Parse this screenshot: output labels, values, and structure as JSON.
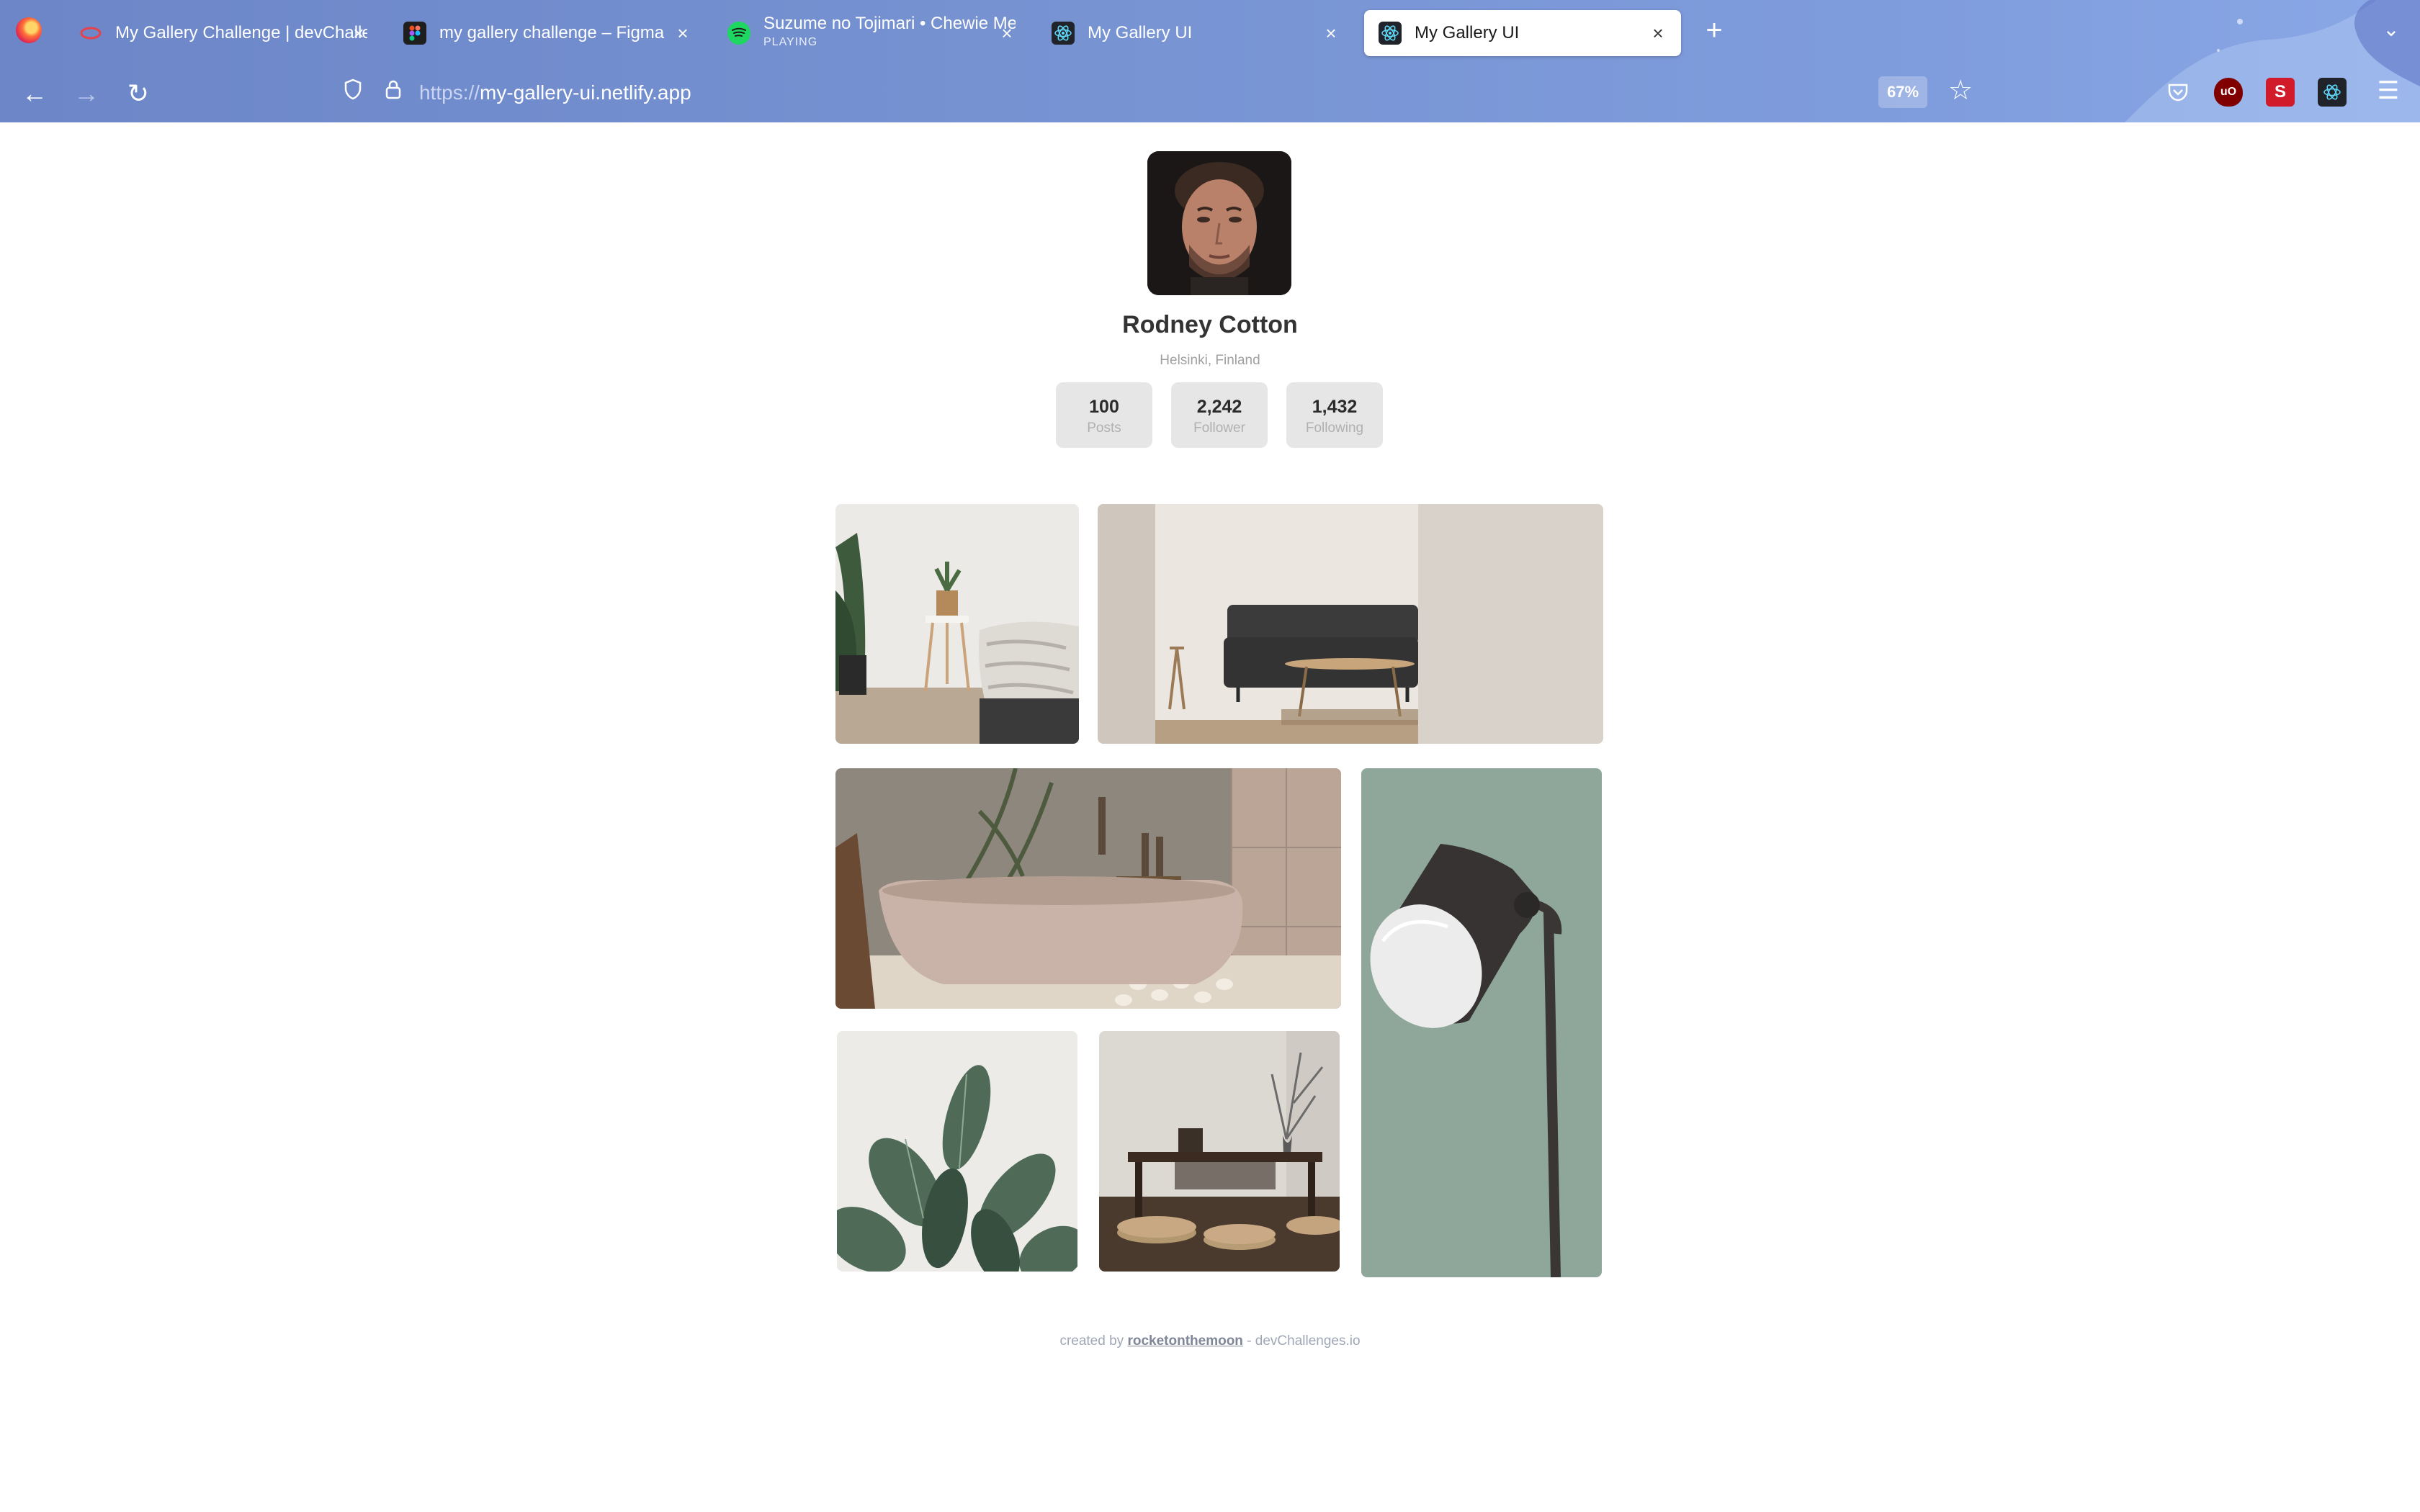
{
  "browser": {
    "tabs": [
      {
        "title": "My Gallery Challenge | devChallenges",
        "subtitle": "",
        "favicon": "devchallenges-icon"
      },
      {
        "title": "my gallery challenge – Figma",
        "subtitle": "",
        "favicon": "figma-icon"
      },
      {
        "title": "Suzume no Tojimari • Chewie Melodies",
        "subtitle": "PLAYING",
        "favicon": "spotify-icon"
      },
      {
        "title": "My Gallery UI",
        "subtitle": "",
        "favicon": "react-icon"
      },
      {
        "title": "My Gallery UI",
        "subtitle": "",
        "favicon": "react-icon"
      }
    ],
    "url_scheme": "https://",
    "url_host": "my-gallery-ui.netlify.app",
    "zoom": "67%"
  },
  "profile": {
    "name": "Rodney Cotton",
    "location": "Helsinki, Finland",
    "stats": [
      {
        "value": "100",
        "label": "Posts"
      },
      {
        "value": "2,242",
        "label": "Follower"
      },
      {
        "value": "1,432",
        "label": "Following"
      }
    ]
  },
  "gallery": {
    "photos": [
      "bedroom-plant-photo",
      "living-room-sofa-photo",
      "bathtub-photo",
      "floor-lamp-photo",
      "rubber-plant-photo",
      "tea-table-photo"
    ]
  },
  "footer": {
    "prefix": "created by",
    "author": "rocketonthemoon",
    "suffix": "- devChallenges.io"
  },
  "colors": {
    "chrome": "#7793d2",
    "stat_bg": "#e6e6e6",
    "name_text": "#333333"
  }
}
